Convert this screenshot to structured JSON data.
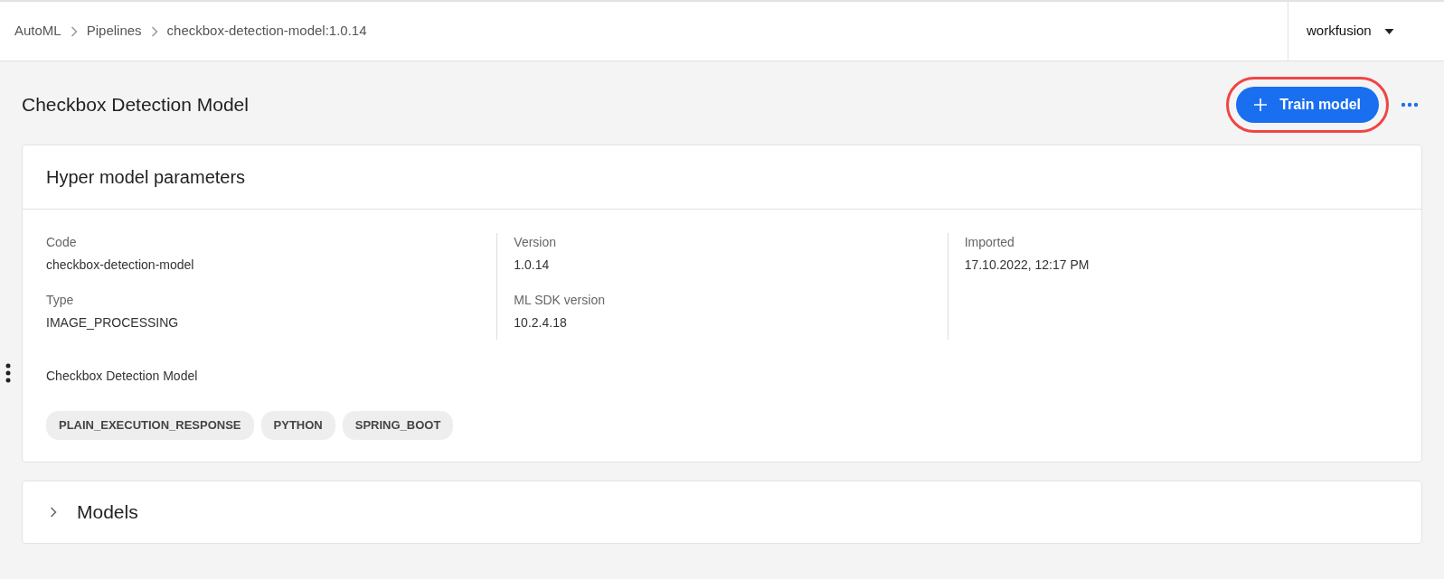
{
  "breadcrumbs": [
    {
      "label": "AutoML"
    },
    {
      "label": "Pipelines"
    },
    {
      "label": "checkbox-detection-model:1.0.14"
    }
  ],
  "account": {
    "label": "workfusion"
  },
  "page": {
    "title": "Checkbox Detection Model",
    "primary_button": {
      "label": "Train model",
      "highlighted": true
    }
  },
  "parameters_card": {
    "title": "Hyper model parameters",
    "columns": [
      [
        {
          "label": "Code",
          "value": "checkbox-detection-model"
        },
        {
          "label": "Type",
          "value": "IMAGE_PROCESSING"
        }
      ],
      [
        {
          "label": "Version",
          "value": "1.0.14"
        },
        {
          "label": "ML SDK version",
          "value": "10.2.4.18"
        }
      ],
      [
        {
          "label": "Imported",
          "value": "17.10.2022, 12:17 PM"
        }
      ]
    ],
    "description": "Checkbox Detection Model",
    "tags": [
      "PLAIN_EXECUTION_RESPONSE",
      "PYTHON",
      "SPRING_BOOT"
    ]
  },
  "models_section": {
    "title": "Models",
    "expanded": false
  }
}
